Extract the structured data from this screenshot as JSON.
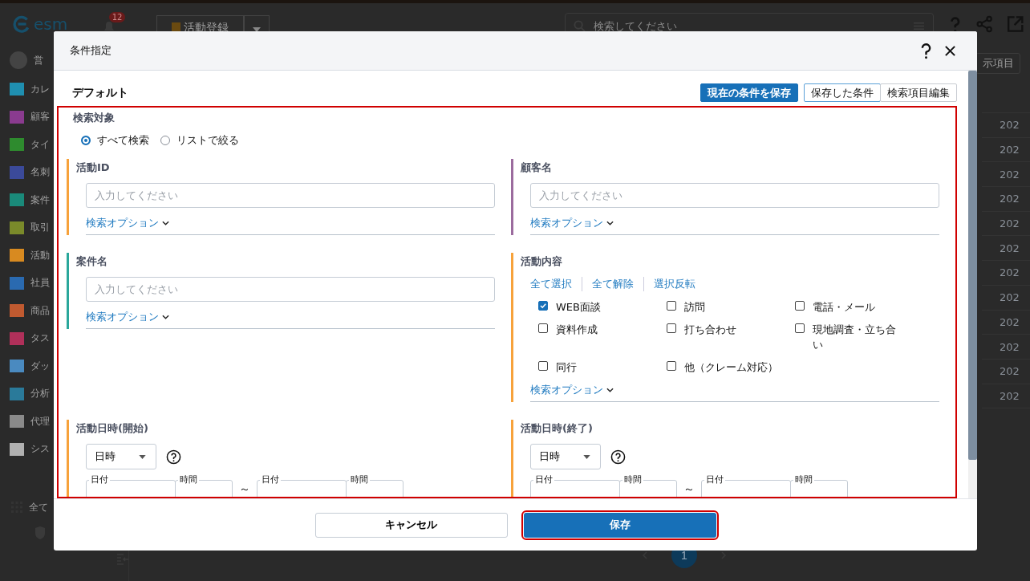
{
  "app": {
    "logo": "esm",
    "notification_count": "12",
    "register_button": "活動登録",
    "search": {
      "placeholder": "検索してください"
    },
    "sidebar": [
      {
        "label": "営",
        "kind": "user"
      },
      {
        "label": "カレ",
        "kind": "item",
        "color": "#1f8fb0"
      },
      {
        "label": "顧客",
        "kind": "item",
        "color": "#8a3b8f"
      },
      {
        "label": "タイ",
        "kind": "item",
        "color": "#2e8b2e"
      },
      {
        "label": "名刺",
        "kind": "item",
        "color": "#3b4a9a"
      },
      {
        "label": "案件",
        "kind": "item",
        "color": "#1a8a7a"
      },
      {
        "label": "取引",
        "kind": "item",
        "color": "#7a8a2a"
      },
      {
        "label": "活動",
        "kind": "item",
        "color": "#d88a20"
      },
      {
        "label": "社員",
        "kind": "item",
        "color": "#2a6ab0"
      },
      {
        "label": "商品",
        "kind": "item",
        "color": "#c05a30"
      },
      {
        "label": "タス",
        "kind": "item",
        "color": "#b0305a"
      },
      {
        "label": "ダッ",
        "kind": "item",
        "color": "#4a8ac0"
      },
      {
        "label": "分析",
        "kind": "item",
        "color": "#2a7a9a"
      },
      {
        "label": "代理",
        "kind": "item",
        "color": "#8a8a8a"
      },
      {
        "label": "シス",
        "kind": "item",
        "color": "#b0b0b0"
      },
      {
        "label": "全て",
        "kind": "grid"
      }
    ],
    "right_button": "示項目",
    "column_cells": [
      "202",
      "202",
      "202",
      "202",
      "202",
      "202",
      "202",
      "202",
      "202",
      "202",
      "202",
      "202"
    ],
    "pagination": [
      {
        "label": "1",
        "selected": true
      }
    ]
  },
  "dialog": {
    "title": "条件指定",
    "preset": "デフォルト",
    "toolbar_buttons": [
      {
        "label": "現在の条件を保存",
        "kind": "primary"
      },
      {
        "label": "保存した条件",
        "kind": "outline"
      },
      {
        "label": "検索項目編集",
        "kind": "plain"
      }
    ],
    "highlighted": true,
    "search_target": {
      "label": "検索対象",
      "options": [
        {
          "label": "すべて検索",
          "selected": true
        },
        {
          "label": "リストで絞る",
          "selected": false
        }
      ]
    },
    "fields": [
      {
        "kind": "text",
        "label": "活動ID",
        "color": "#f7a23b",
        "placeholder": "入力してください",
        "option_link": "検索オプション"
      },
      {
        "kind": "text",
        "label": "顧客名",
        "color": "#9b6b9e",
        "placeholder": "入力してください",
        "option_link": "検索オプション"
      },
      {
        "kind": "text",
        "label": "案件名",
        "color": "#2aa79b",
        "placeholder": "入力してください",
        "option_link": "検索オプション"
      },
      {
        "kind": "checklist",
        "label": "活動内容",
        "color": "#f7a23b",
        "actions": [
          "全て選択",
          "全て解除",
          "選択反転"
        ],
        "option_link": "検索オプション",
        "options": [
          {
            "label": "WEB面談",
            "checked": true
          },
          {
            "label": "訪問",
            "checked": false
          },
          {
            "label": "電話・メール",
            "checked": false
          },
          {
            "label": "資料作成",
            "checked": false
          },
          {
            "label": "打ち合わせ",
            "checked": false
          },
          {
            "label": "現地調査・立ち合い",
            "checked": false
          },
          {
            "label": "同行",
            "checked": false
          },
          {
            "label": "他（クレーム対応）",
            "checked": false
          }
        ]
      },
      {
        "kind": "datetime",
        "label": "活動日時(開始)",
        "color": "#f7a23b",
        "mode": "日時",
        "range_parts": [
          "日付",
          "時間",
          "日付",
          "時間"
        ],
        "separator": "～"
      },
      {
        "kind": "datetime",
        "label": "活動日時(終了)",
        "color": "#f7a23b",
        "mode": "日時",
        "range_parts": [
          "日付",
          "時間",
          "日付",
          "時間"
        ],
        "separator": "～"
      }
    ],
    "footer": {
      "cancel": "キャンセル",
      "save": "保存",
      "save_highlighted": true
    }
  }
}
